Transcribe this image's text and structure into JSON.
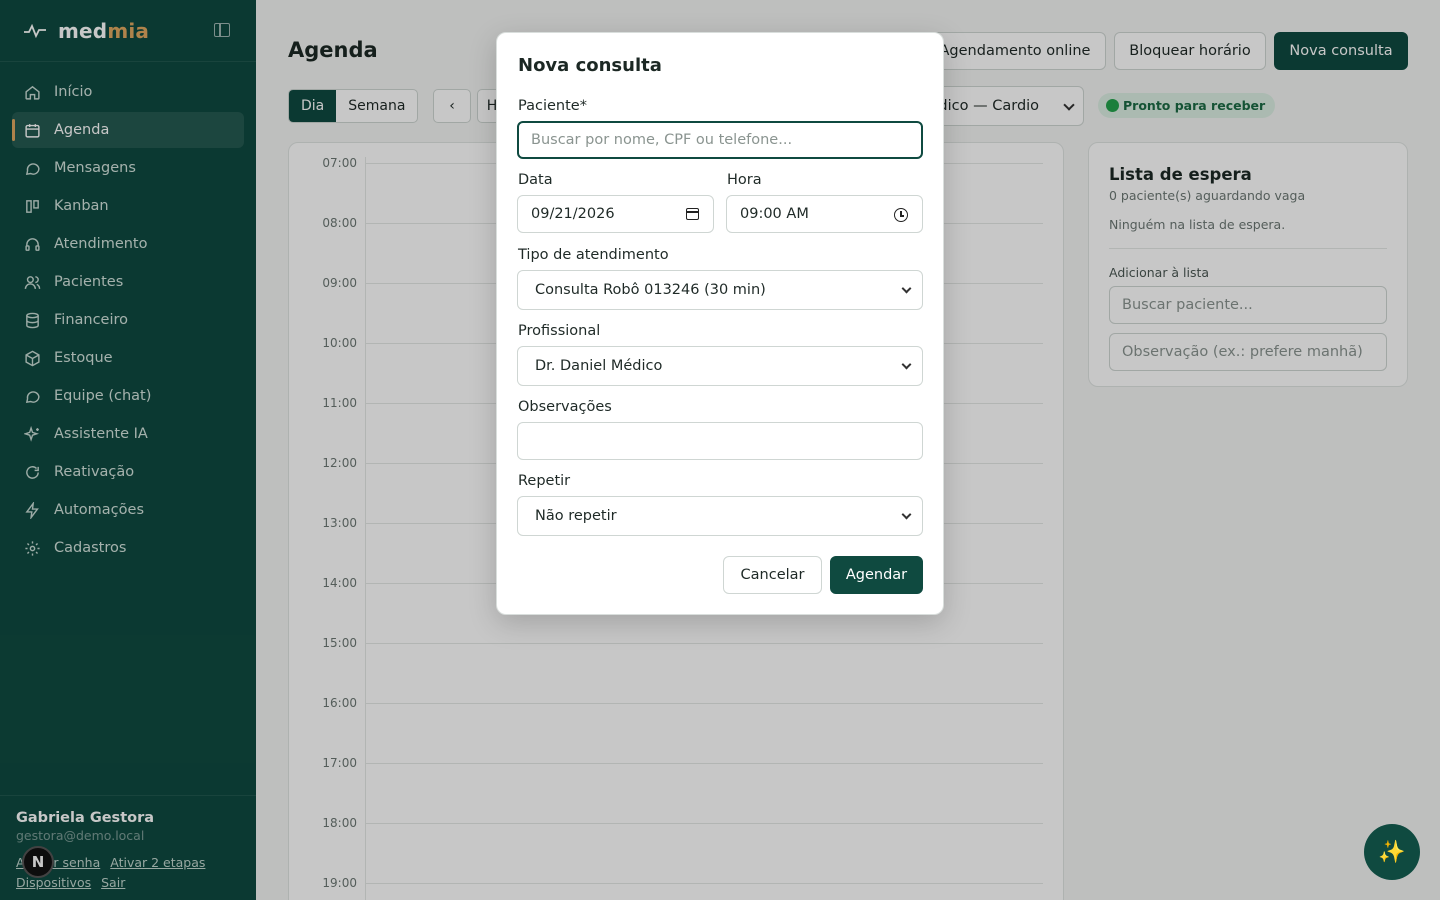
{
  "sidebar": {
    "logo_a": "med",
    "logo_b": "mia",
    "items": [
      {
        "label": "Início",
        "icon": "home-icon"
      },
      {
        "label": "Agenda",
        "icon": "calendar-icon"
      },
      {
        "label": "Mensagens",
        "icon": "message-icon"
      },
      {
        "label": "Kanban",
        "icon": "kanban-icon"
      },
      {
        "label": "Atendimento",
        "icon": "headset-icon"
      },
      {
        "label": "Pacientes",
        "icon": "users-icon"
      },
      {
        "label": "Financeiro",
        "icon": "database-icon"
      },
      {
        "label": "Estoque",
        "icon": "box-icon"
      },
      {
        "label": "Equipe (chat)",
        "icon": "chat-icon"
      },
      {
        "label": "Assistente IA",
        "icon": "sparkles-icon"
      },
      {
        "label": "Reativação",
        "icon": "refresh-icon"
      },
      {
        "label": "Automações",
        "icon": "bolt-icon"
      },
      {
        "label": "Cadastros",
        "icon": "gear-icon"
      }
    ],
    "user": {
      "name": "Gabriela Gestora",
      "email": "gestora@demo.local",
      "link_password": "Alterar senha",
      "link_2fa": "Ativar 2 etapas",
      "link_devices": "Dispositivos",
      "link_logout": "Sair",
      "badge": "N"
    }
  },
  "header": {
    "title": "Agenda",
    "btn_online": "Agendamento online",
    "btn_block": "Bloquear horário",
    "btn_new": "Nova consulta"
  },
  "toolbar": {
    "day": "Dia",
    "week": "Semana",
    "prev": "‹",
    "today_partial": "H",
    "professional": "Médico — Cardio",
    "ready": "Pronto para receber"
  },
  "calendar": {
    "hours": [
      "07:00",
      "08:00",
      "09:00",
      "10:00",
      "11:00",
      "12:00",
      "13:00",
      "14:00",
      "15:00",
      "16:00",
      "17:00",
      "18:00",
      "19:00"
    ]
  },
  "waitlist": {
    "title": "Lista de espera",
    "count": "0 paciente(s) aguardando vaga",
    "empty": "Ninguém na lista de espera.",
    "add_label": "Adicionar à lista",
    "search_placeholder": "Buscar paciente...",
    "note_placeholder": "Observação (ex.: prefere manhã)"
  },
  "modal": {
    "title": "Nova consulta",
    "patient_label": "Paciente*",
    "patient_placeholder": "Buscar por nome, CPF ou telefone...",
    "date_label": "Data",
    "date_value": "09/21/2026",
    "time_label": "Hora",
    "time_value": "09:00 AM",
    "type_label": "Tipo de atendimento",
    "type_value": "Consulta Robô 013246 (30 min)",
    "pro_label": "Profissional",
    "pro_value": "Dr. Daniel Médico",
    "notes_label": "Observações",
    "repeat_label": "Repetir",
    "repeat_value": "Não repetir",
    "cancel": "Cancelar",
    "submit": "Agendar"
  },
  "fab_icon": "✨",
  "colors": {
    "brand": "#0f4a40",
    "accent": "#e0a860",
    "ready_bg": "#dcefe3",
    "ready_text": "#1b6b45"
  }
}
